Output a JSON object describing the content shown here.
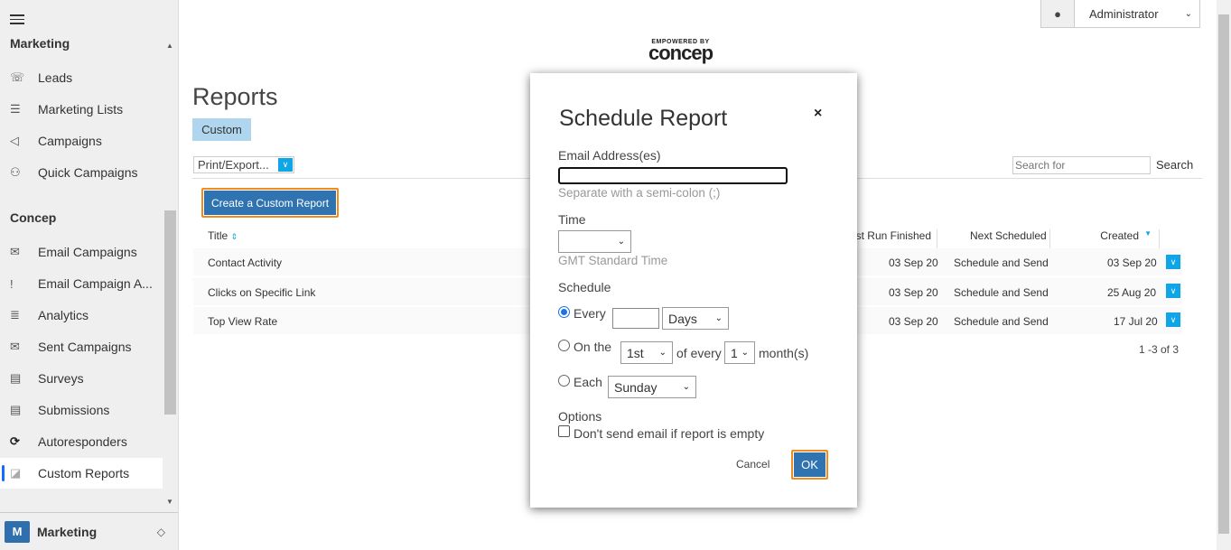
{
  "sidebar": {
    "group1": "Marketing",
    "items1": [
      {
        "label": "Leads",
        "icon": "phone-gear-icon"
      },
      {
        "label": "Marketing Lists",
        "icon": "list-icon"
      },
      {
        "label": "Campaigns",
        "icon": "megaphone-icon"
      },
      {
        "label": "Quick Campaigns",
        "icon": "quick-campaign-icon"
      }
    ],
    "group2": "Concep",
    "items2": [
      {
        "label": "Email Campaigns",
        "icon": "envelope-icon"
      },
      {
        "label": "Email Campaign A...",
        "icon": "exclamation-icon"
      },
      {
        "label": "Analytics",
        "icon": "database-icon"
      },
      {
        "label": "Sent Campaigns",
        "icon": "envelope-open-icon"
      },
      {
        "label": "Surveys",
        "icon": "clipboard-icon"
      },
      {
        "label": "Submissions",
        "icon": "clipboard-check-icon"
      },
      {
        "label": "Autoresponders",
        "icon": "refresh-icon"
      },
      {
        "label": "Custom Reports",
        "icon": "chart-area-icon",
        "active": true
      }
    ],
    "area": {
      "badge": "M",
      "label": "Marketing"
    }
  },
  "header": {
    "user": "Administrator",
    "logo_small": "EMPOWERED BY",
    "logo_text": "concep"
  },
  "page": {
    "title": "Reports",
    "tab": "Custom",
    "print_export": "Print/Export...",
    "search_placeholder": "Search for",
    "search_label": "Search",
    "create_button": "Create a Custom Report"
  },
  "table": {
    "columns": {
      "title": "Title",
      "last_run": "Last Run Finished",
      "next": "Next Scheduled",
      "created": "Created"
    },
    "rows": [
      {
        "title": "Contact Activity",
        "last_run": "03 Sep 20",
        "next": "Schedule and Send",
        "created": "03 Sep 20"
      },
      {
        "title": "Clicks on Specific Link",
        "last_run": "03 Sep 20",
        "next": "Schedule and Send",
        "created": "25 Aug 20"
      },
      {
        "title": "Top View Rate",
        "last_run": "03 Sep 20",
        "next": "Schedule and Send",
        "created": "17 Jul 20"
      }
    ],
    "pager": "1 -3 of 3"
  },
  "modal": {
    "title": "Schedule Report",
    "close": "×",
    "email_label": "Email Address(es)",
    "email_value": "",
    "email_hint": "Separate with a semi-colon (;)",
    "time_label": "Time",
    "time_value": "",
    "timezone": "GMT Standard Time",
    "schedule_label": "Schedule",
    "every_label": "Every",
    "every_value": "",
    "every_unit": "Days",
    "onthe_label": "On the",
    "onthe_day": "1st",
    "of_every": "of every",
    "month_count": "1",
    "months": "month(s)",
    "each_label": "Each",
    "each_day": "Sunday",
    "selected_schedule": "Every",
    "options_label": "Options",
    "option_empty": "Don't send email if report is empty",
    "option_empty_checked": false,
    "cancel": "Cancel",
    "ok": "OK"
  }
}
